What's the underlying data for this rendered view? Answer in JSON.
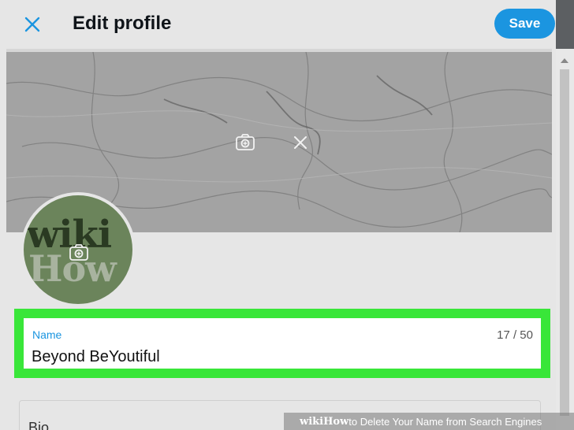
{
  "header": {
    "title": "Edit profile",
    "save_label": "Save"
  },
  "icons": {
    "close": "close-icon",
    "banner_camera": "camera-icon",
    "banner_remove": "close-icon",
    "avatar_camera": "camera-icon"
  },
  "avatar": {
    "line1": "wiki",
    "line2": "How"
  },
  "name_field": {
    "label": "Name",
    "value": "Beyond BeYoutiful",
    "count": "17 / 50"
  },
  "bio_field": {
    "label": "Bio"
  },
  "watermark": {
    "logo": "wikiHow",
    "text": " to Delete Your Name from Search Engines"
  },
  "colors": {
    "accent": "#1b95e0",
    "highlight": "#39e639",
    "background": "#e6e6e6",
    "avatar": "#6b845b"
  }
}
